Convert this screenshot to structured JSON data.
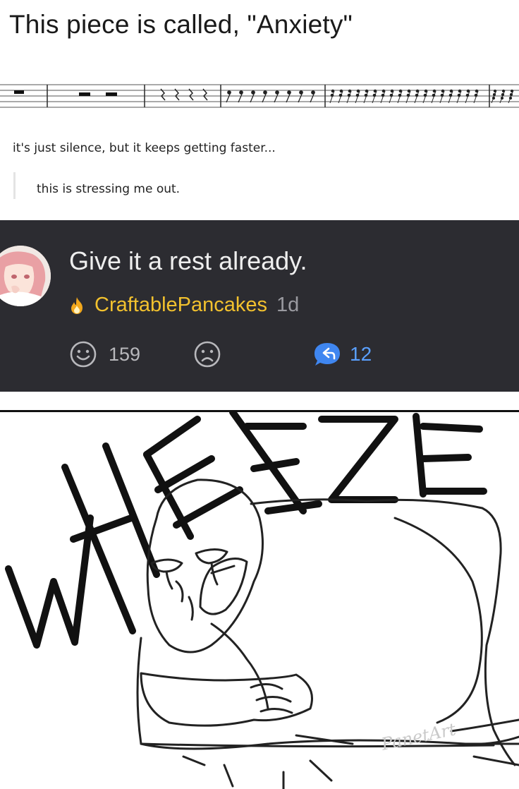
{
  "post": {
    "title": "This piece is called, \"Anxiety\"",
    "caption": "it's just silence, but it keeps getting faster...",
    "reply": "this is stressing me out."
  },
  "comment": {
    "text": "Give it a rest already.",
    "username": "CraftablePancakes",
    "time": "1d",
    "happy_count": "159",
    "replies_count": "12",
    "icons": [
      "flame-icon",
      "smiley-icon",
      "sad-face-icon",
      "reply-icon"
    ],
    "colors": {
      "background": "#2c2c31",
      "username": "#f2c12e",
      "reply": "#5aa0ff"
    }
  },
  "meme": {
    "word": "WHEEZE",
    "signature": "PanetArt"
  }
}
